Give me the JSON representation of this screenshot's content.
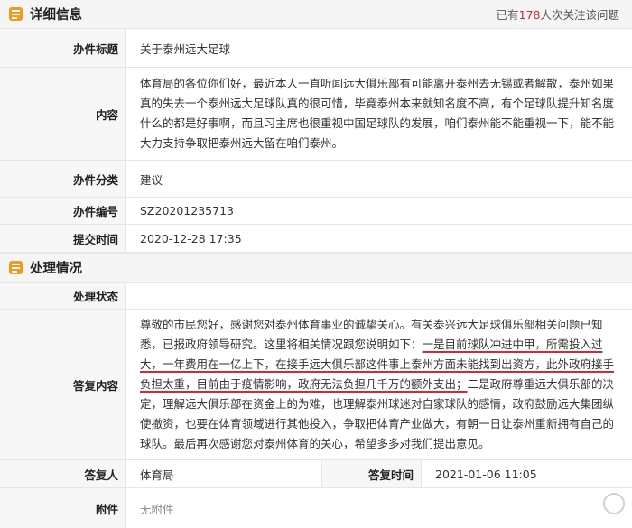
{
  "detail": {
    "title": "详细信息",
    "views_prefix": "已有",
    "views_count": "178",
    "views_suffix": "人次关注该问题",
    "fields": {
      "subject_label": "办件标题",
      "subject_value": "关于泰州远大足球",
      "content_label": "内容",
      "content_value": "体育局的各位你们好，最近本人一直听闻远大俱乐部有可能离开泰州去无锡或者解散，泰州如果真的失去一个泰州远大足球队真的很可惜，毕竟泰州本来就知名度不高，有个足球队提升知名度什么的都是好事啊，而且习主席也很重视中国足球队的发展，咱们泰州能不能重视一下，能不能大力支持争取把泰州远大留在咱们泰州。",
      "category_label": "办件分类",
      "category_value": "建议",
      "number_label": "办件编号",
      "number_value": "SZ20201235713",
      "submit_time_label": "提交时间",
      "submit_time_value": "2020-12-28 17:35"
    }
  },
  "handling": {
    "title": "处理情况",
    "status_label": "处理状态",
    "status_value": "",
    "reply_label": "答复内容",
    "reply_part1": "尊敬的市民您好，感谢您对泰州体育事业的诚挚关心。有关泰兴远大足球俱乐部相关问题已知悉，已报政府领导研究。这里将相关情况跟您说明如下：",
    "reply_part2": "一是目前球队冲进中甲，所需投入过大，一年费用在一亿上下，在接手远大俱乐部这件事上泰州方面未能找到出资方，此外政府接手负担太重，目前由于疫情影响，政府无法负担几千万的额外支出；",
    "reply_part3": "二是政府尊重远大俱乐部的决定，理解远大俱乐部在资金上的为难，也理解泰州球迷对自家球队的感情，政府鼓励远大集团纵使撤资，也要在体育领域进行其他投入，争取把体育产业做大，有朝一日让泰州重新拥有自己的球队。最后再次感谢您对泰州体育的关心，希望多多对我们提出意见。",
    "replier_label": "答复人",
    "replier_value": "体育局",
    "reply_time_label": "答复时间",
    "reply_time_value": "2021-01-06 11:05",
    "attachment_label": "附件",
    "attachment_value": "无附件"
  },
  "colors": {
    "accent_orange": "#f39a1e",
    "highlight_red": "#d9272e"
  }
}
